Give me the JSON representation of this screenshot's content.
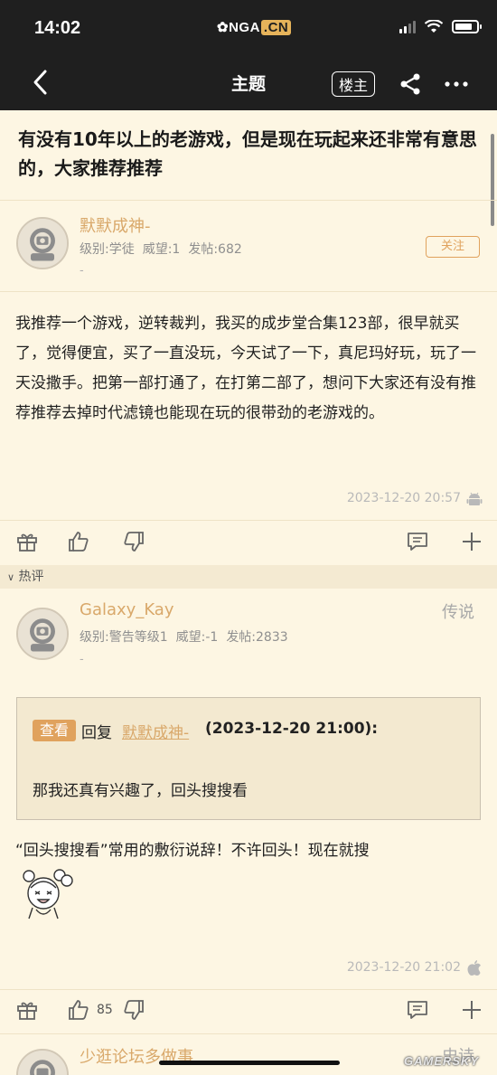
{
  "status_bar": {
    "time": "14:02",
    "logo_main": "NGA",
    "logo_suffix": ".CN"
  },
  "nav": {
    "title": "主题",
    "owner_only": "楼主"
  },
  "thread": {
    "title": "有没有10年以上的老游戏，但是现在玩起来还非常有意思的，大家推荐推荐"
  },
  "op": {
    "username": "默默成神-",
    "level": "级别:学徒",
    "prestige": "威望:1",
    "posts": "发帖:682",
    "dash": "-",
    "follow": "关注",
    "content": "我推荐一个游戏，逆转裁判，我买的成步堂合集123部，很早就买了，觉得便宜，买了一直没玩，今天试了一下，真尼玛好玩，玩了一天没撒手。把第一部打通了，在打第二部了，想问下大家还有没有推荐推荐去掉时代滤镜也能现在玩的很带劲的老游戏的。",
    "timestamp": "2023-12-20 20:57"
  },
  "hot_section": {
    "label": "热评"
  },
  "reply": {
    "username": "Galaxy_Kay",
    "tag": "传说",
    "level": "级别:警告等级1",
    "prestige": "威望:-1",
    "posts": "发帖:2833",
    "dash": "-",
    "quote": {
      "view": "查看",
      "reply_word": "回复",
      "quoted_user": "默默成神-",
      "quoted_time": "(2023-12-20 21:00):",
      "text": "那我还真有兴趣了，回头搜搜看"
    },
    "content": "“回头搜搜看”常用的敷衍说辞！不许回头！现在就搜",
    "timestamp": "2023-12-20 21:02",
    "like_count": "85"
  },
  "next_reply": {
    "username": "少逛论坛多做事",
    "tag": "史诗"
  },
  "watermark": "GAMERSKY",
  "colors": {
    "accent": "#e0a25d",
    "username": "#d9a86a",
    "background": "#fdf6e3",
    "topbar": "#1f1f1f"
  }
}
